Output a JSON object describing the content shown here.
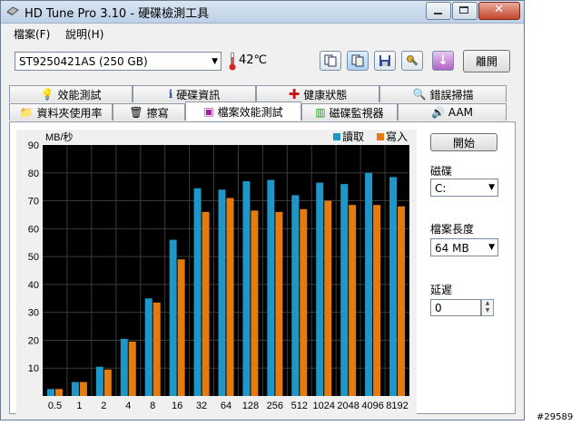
{
  "window": {
    "title": "HD Tune Pro 3.10 - 硬碟檢測工具"
  },
  "menu": {
    "items": [
      "檔案(F)",
      "說明(H)"
    ]
  },
  "toolbar": {
    "drive": "ST9250421AS (250 GB)",
    "temperature": "42℃",
    "exit_label": "離開"
  },
  "tabs": {
    "row1": [
      "效能測試",
      "硬碟資訊",
      "健康狀態",
      "錯誤掃描"
    ],
    "row2": [
      "資料夾使用率",
      "擦寫",
      "檔案效能測試",
      "磁碟監視器",
      "AAM"
    ],
    "active": "檔案效能測試"
  },
  "side": {
    "start_label": "開始",
    "disk_label": "磁碟",
    "disk_value": "C:",
    "file_length_label": "檔案長度",
    "file_length_value": "64 MB",
    "delay_label": "延遲",
    "delay_value": "0"
  },
  "watermark": "#29589",
  "colors": {
    "read": "#1e96c8",
    "write": "#e57a0f",
    "plot_bg": "#000000"
  },
  "chart_data": {
    "type": "bar",
    "categories": [
      "0.5",
      "1",
      "2",
      "4",
      "8",
      "16",
      "32",
      "64",
      "128",
      "256",
      "512",
      "1024",
      "2048",
      "4096",
      "8192"
    ],
    "series": [
      {
        "name": "讀取",
        "values": [
          2.5,
          5,
          10.5,
          20.5,
          35,
          56,
          74.5,
          74,
          77,
          77.5,
          72,
          76.5,
          76,
          80,
          78.5
        ]
      },
      {
        "name": "寫入",
        "values": [
          2.5,
          5,
          9.5,
          19.5,
          33.5,
          49,
          66,
          71,
          66.5,
          66,
          67,
          70,
          68.5,
          68.5,
          68
        ]
      }
    ],
    "ylabel": "MB/秒",
    "ylim": [
      0,
      90
    ],
    "yticks": [
      10,
      20,
      30,
      40,
      50,
      60,
      70,
      80,
      90
    ],
    "grid": true,
    "legend": "top-right"
  }
}
